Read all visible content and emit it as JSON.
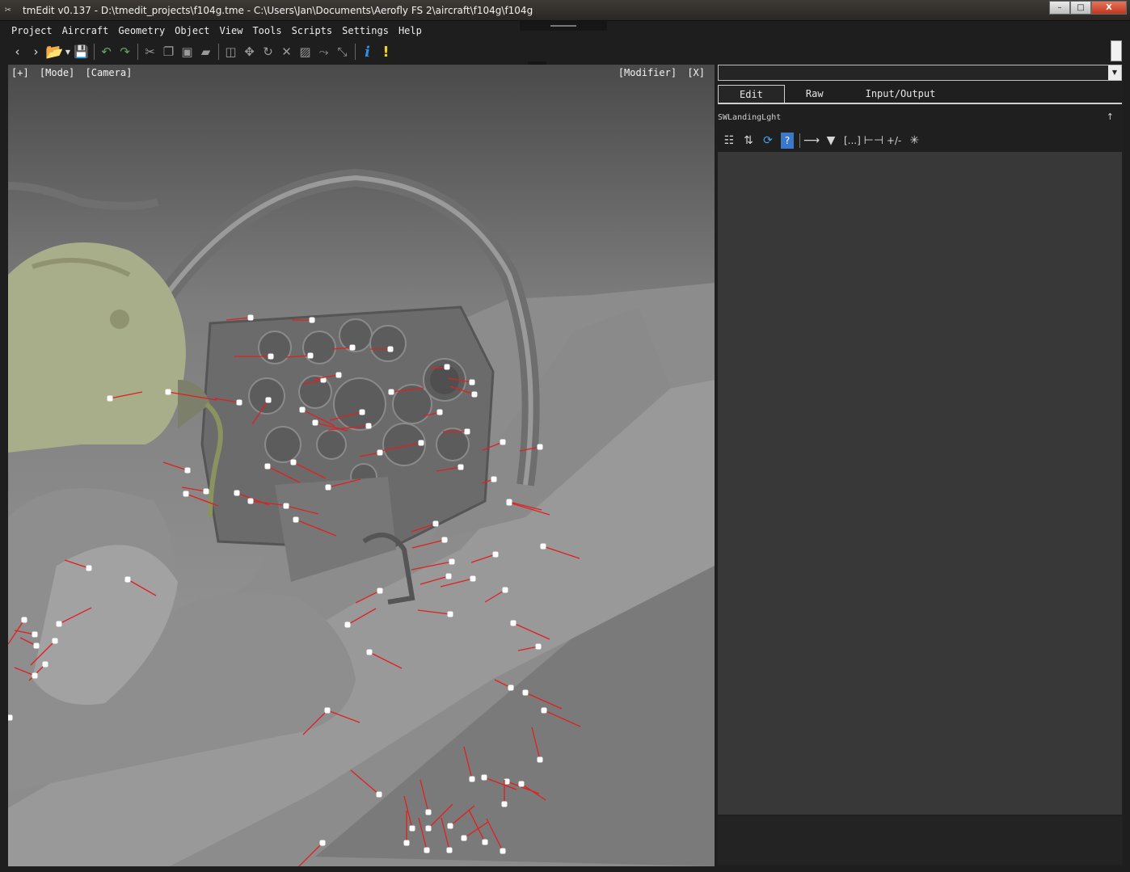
{
  "window": {
    "title": "tmEdit v0.137 - D:\\tmedit_projects\\f104g.tme - C:\\Users\\Jan\\Documents\\Aerofly FS 2\\aircraft\\f104g\\f104g",
    "app_icon": "tools-icon",
    "minimize": "–",
    "maximize": "□",
    "close": "X"
  },
  "menu": [
    "Project",
    "Aircraft",
    "Geometry",
    "Object",
    "View",
    "Tools",
    "Scripts",
    "Settings",
    "Help"
  ],
  "toolbar": {
    "back": "‹",
    "forward": "›",
    "icons": [
      "open-folder-icon",
      "save-icon",
      "undo-icon",
      "redo-icon",
      "cut-icon",
      "copy-icon",
      "paste-icon",
      "delete-icon",
      "mirror-icon",
      "move-icon",
      "rotate-icon",
      "scale-icon",
      "hatch-icon",
      "snap-icon",
      "connect-icon",
      "info-icon",
      "warning-icon"
    ]
  },
  "viewport": {
    "left_buttons": [
      "[+]",
      "[Mode]",
      "[Camera]"
    ],
    "right_buttons": [
      "[Modifier]",
      "[X]"
    ]
  },
  "panel": {
    "combo_value": "",
    "tabs": [
      "Edit",
      "Raw",
      "Input/Output"
    ],
    "active_tab": "Edit",
    "object_name": "SWLandingLght",
    "pin": "↑",
    "tool_text": [
      "[...]",
      "+/-"
    ]
  },
  "colors": {
    "viewport_top": "#4a4a4a",
    "viewport_bottom": "#a0a0a0",
    "handle_line": "#e02020",
    "handle_point": "#ffffff",
    "helmet": "#a8ad8a"
  }
}
